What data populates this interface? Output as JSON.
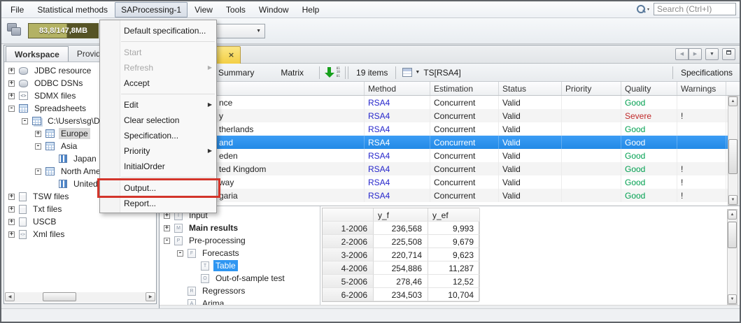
{
  "menubar": {
    "items": [
      {
        "label": "File"
      },
      {
        "label": "Statistical methods"
      },
      {
        "label": "SAProcessing-1",
        "active": true
      },
      {
        "label": "View"
      },
      {
        "label": "Tools"
      },
      {
        "label": "Window"
      },
      {
        "label": "Help"
      }
    ],
    "search": {
      "placeholder": "Search (Ctrl+I)"
    }
  },
  "toolbar": {
    "memory": "83,8/147,8MB"
  },
  "workspace_panel": {
    "tabs": [
      {
        "label": "Workspace",
        "selected": true
      },
      {
        "label": "Provide"
      }
    ],
    "tree": [
      {
        "label": "JDBC resource",
        "indent": 0,
        "expander": "+",
        "icon": "database"
      },
      {
        "label": "ODBC DSNs",
        "indent": 0,
        "expander": "+",
        "icon": "database"
      },
      {
        "label": "SDMX files",
        "indent": 0,
        "expander": "+",
        "icon": "sdmx"
      },
      {
        "label": "Spreadsheets",
        "indent": 0,
        "expander": "-",
        "icon": "spreadsheet"
      },
      {
        "label": "C:\\Users\\sg\\De",
        "indent": 1,
        "expander": "-",
        "icon": "workbook"
      },
      {
        "label": "Europe",
        "indent": 2,
        "expander": "+",
        "icon": "sheet",
        "selected": "inactive"
      },
      {
        "label": "Asia",
        "indent": 2,
        "expander": "-",
        "icon": "sheet"
      },
      {
        "label": "Japan",
        "indent": 3,
        "icon": "series"
      },
      {
        "label": "North Ame",
        "indent": 2,
        "expander": "-",
        "icon": "sheet"
      },
      {
        "label": "United",
        "indent": 3,
        "icon": "series"
      },
      {
        "label": "TSW files",
        "indent": 0,
        "expander": "+",
        "icon": "doc"
      },
      {
        "label": "Txt files",
        "indent": 0,
        "expander": "+",
        "icon": "doc"
      },
      {
        "label": "USCB",
        "indent": 0,
        "expander": "+",
        "icon": "doc-plain"
      },
      {
        "label": "Xml files",
        "indent": 0,
        "expander": "+",
        "icon": "xml"
      }
    ]
  },
  "context_menu": {
    "items": [
      {
        "type": "item",
        "label": "Default specification..."
      },
      {
        "type": "separator"
      },
      {
        "type": "item",
        "label": "Start",
        "disabled": true
      },
      {
        "type": "item",
        "label": "Refresh",
        "disabled": true,
        "submenu": true
      },
      {
        "type": "item",
        "label": "Accept"
      },
      {
        "type": "separator"
      },
      {
        "type": "item",
        "label": "Edit",
        "submenu": true
      },
      {
        "type": "item",
        "label": "Clear selection"
      },
      {
        "type": "item",
        "label": "Specification..."
      },
      {
        "type": "item",
        "label": "Priority",
        "submenu": true
      },
      {
        "type": "item",
        "label": "InitialOrder"
      },
      {
        "type": "separator"
      },
      {
        "type": "item",
        "label": "Output...",
        "annotated": true
      },
      {
        "type": "item",
        "label": "Report..."
      }
    ]
  },
  "main_panel": {
    "toolbar": {
      "buttons": [
        "Summary",
        "Matrix"
      ],
      "items_count": "19 items",
      "ts_selector": "TS[RSA4]",
      "right_label": "Specifications"
    },
    "grid": {
      "columns": [
        "",
        "Method",
        "Estimation",
        "Status",
        "Priority",
        "Quality",
        "Warnings"
      ],
      "rows": [
        {
          "name": "nce",
          "method": "RSA4",
          "estimation": "Concurrent",
          "status": "Valid",
          "priority": "",
          "quality": "Good",
          "quality_color": "green",
          "warnings": ""
        },
        {
          "name": "y",
          "method": "RSA4",
          "estimation": "Concurrent",
          "status": "Valid",
          "priority": "",
          "quality": "Severe",
          "quality_color": "red",
          "warnings": "!"
        },
        {
          "name": "therlands",
          "method": "RSA4",
          "estimation": "Concurrent",
          "status": "Valid",
          "priority": "",
          "quality": "Good",
          "quality_color": "green",
          "warnings": ""
        },
        {
          "name": "and",
          "method": "RSA4",
          "estimation": "Concurrent",
          "status": "Valid",
          "priority": "",
          "quality": "Good",
          "quality_color": "green",
          "warnings": "",
          "selected": true
        },
        {
          "name": "eden",
          "method": "RSA4",
          "estimation": "Concurrent",
          "status": "Valid",
          "priority": "",
          "quality": "Good",
          "quality_color": "green",
          "warnings": ""
        },
        {
          "name": "ted Kingdom",
          "method": "RSA4",
          "estimation": "Concurrent",
          "status": "Valid",
          "priority": "",
          "quality": "Good",
          "quality_color": "green",
          "warnings": "!"
        },
        {
          "name": "way",
          "method": "RSA4",
          "estimation": "Concurrent",
          "status": "Valid",
          "priority": "",
          "quality": "Good",
          "quality_color": "green",
          "warnings": "!"
        },
        {
          "name": "garia",
          "method": "RSA4",
          "estimation": "Concurrent",
          "status": "Valid",
          "priority": "",
          "quality": "Good",
          "quality_color": "green",
          "warnings": "!"
        }
      ]
    },
    "detail_tree": [
      {
        "label": "Input",
        "icon": "I",
        "indent": 0,
        "expander": "+"
      },
      {
        "label": "Main results",
        "icon": "M",
        "indent": 0,
        "expander": "+",
        "bold": true
      },
      {
        "label": "Pre-processing",
        "icon": "P",
        "indent": 0,
        "expander": "-"
      },
      {
        "label": "Forecasts",
        "icon": "F",
        "indent": 1,
        "expander": "-"
      },
      {
        "label": "Table",
        "icon": "T",
        "indent": 2,
        "selected": "active"
      },
      {
        "label": "Out-of-sample test",
        "icon": "O",
        "indent": 2
      },
      {
        "label": "Regressors",
        "icon": "R",
        "indent": 1
      },
      {
        "label": "Arima",
        "icon": "A",
        "indent": 1
      }
    ],
    "forecast_table": {
      "columns": [
        "",
        "y_f",
        "y_ef"
      ],
      "rows": [
        [
          "1-2006",
          "236,568",
          "9,993"
        ],
        [
          "2-2006",
          "225,508",
          "9,679"
        ],
        [
          "3-2006",
          "220,714",
          "9,623"
        ],
        [
          "4-2006",
          "254,886",
          "11,287"
        ],
        [
          "5-2006",
          "278,46",
          "12,52"
        ],
        [
          "6-2006",
          "234,503",
          "10,704"
        ]
      ]
    }
  },
  "colors": {
    "selection_top": "#3b9cf5",
    "selection_bottom": "#238ae6",
    "selection": "#2f96f2",
    "method_blue": "#2626cc",
    "quality_good": "#00a050",
    "quality_severe": "#c02a2a",
    "annotation_red": "#d3352b",
    "tab_yellow_top": "#fbe684",
    "tab_yellow_bottom": "#f3cf45"
  }
}
